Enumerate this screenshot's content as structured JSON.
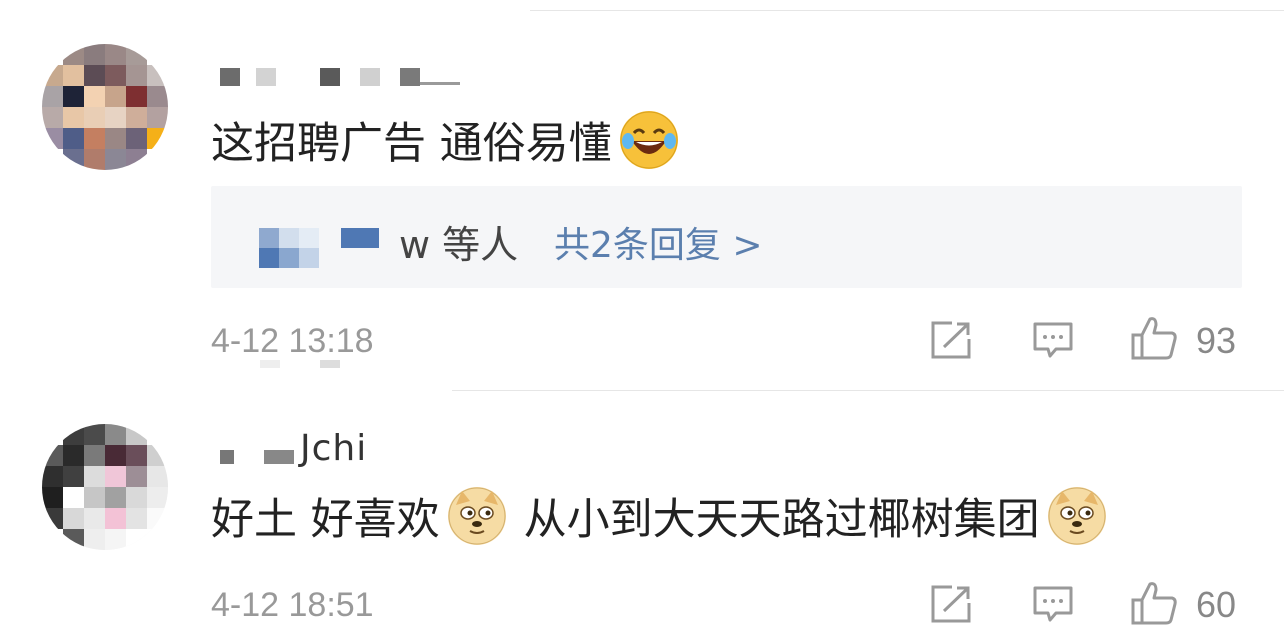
{
  "comments": [
    {
      "username": "",
      "text_before_emoji": "这招聘广告 通俗易懂",
      "emoji_name": "laughing-tears-emoji",
      "reply_summary": {
        "names_suffix": "w 等人",
        "link": "共2条回复 >"
      },
      "time": "4-12 13:18",
      "like_count": "93"
    },
    {
      "username": "Jchi",
      "text_part1": "好土 好喜欢",
      "emoji_name": "doge-emoji",
      "text_part2": "从小到大天天路过椰树集团",
      "time": "4-12 18:51",
      "like_count": "60"
    }
  ],
  "colors": {
    "link_blue": "#5b7fae",
    "meta_gray": "#999999",
    "reply_bg": "#f5f6f8"
  },
  "icons": [
    "share-icon",
    "comment-icon",
    "thumbs-up-icon"
  ]
}
